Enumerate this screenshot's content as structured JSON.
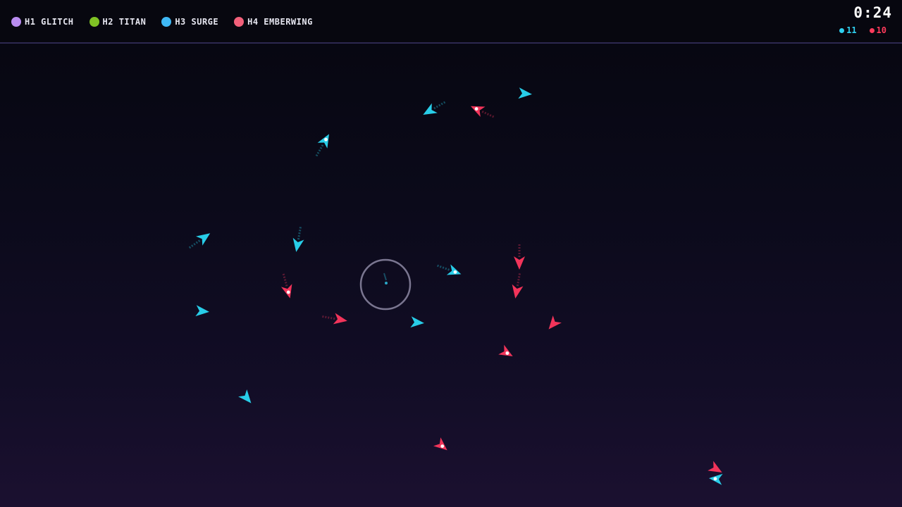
{
  "hud": {
    "heroes": [
      {
        "id": "hero-1",
        "label": "H1 GLITCH",
        "color": "#b98cf0"
      },
      {
        "id": "hero-2",
        "label": "H2 TITAN",
        "color": "#7fc224"
      },
      {
        "id": "hero-3",
        "label": "H3 SURGE",
        "color": "#3fb8f5"
      },
      {
        "id": "hero-4",
        "label": "H4 EMBERWING",
        "color": "#f2607a"
      }
    ],
    "timer": "0:24",
    "scores": {
      "cyan": {
        "value": "11",
        "color": "#2fd0f0"
      },
      "red": {
        "value": "10",
        "color": "#ff3b5c"
      }
    }
  },
  "arena": {
    "team_colors": {
      "cyan": "#28cde8",
      "red": "#f2345a"
    },
    "ring_color": "#7a7690",
    "ships": [
      {
        "team": "cyan",
        "heading": 0,
        "core": false,
        "trail": 0
      },
      {
        "team": "red",
        "heading": 0,
        "core": true,
        "trail": 1
      },
      {
        "team": "cyan",
        "heading": 0,
        "core": false,
        "trail": 1
      },
      {
        "team": "cyan",
        "heading": 0,
        "core": true,
        "trail": 1
      },
      {
        "team": "cyan",
        "heading": 0,
        "core": false,
        "trail": 1
      },
      {
        "team": "cyan",
        "heading": 0,
        "core": false,
        "trail": 1
      },
      {
        "team": "red",
        "heading": 0,
        "core": false,
        "trail": 1
      },
      {
        "team": "red",
        "heading": 0,
        "core": false,
        "trail": 1
      },
      {
        "team": "cyan",
        "heading": 0,
        "core": true,
        "trail": 1
      },
      {
        "team": "red",
        "heading": 0,
        "core": true,
        "trail": 1
      },
      {
        "team": "cyan",
        "heading": 0,
        "core": false,
        "trail": 0
      },
      {
        "team": "red",
        "heading": 0,
        "core": false,
        "trail": 1
      },
      {
        "team": "cyan",
        "heading": 0,
        "core": false,
        "trail": 0
      },
      {
        "team": "red",
        "heading": 0,
        "core": false,
        "trail": 0
      },
      {
        "team": "red",
        "heading": 0,
        "core": true,
        "trail": 0
      },
      {
        "team": "cyan",
        "heading": 0,
        "core": false,
        "trail": 0
      },
      {
        "team": "red",
        "heading": 0,
        "core": true,
        "trail": 0
      },
      {
        "team": "red",
        "heading": 0,
        "core": false,
        "trail": 0
      },
      {
        "team": "cyan",
        "heading": 0,
        "core": true,
        "trail": 0
      },
      {
        "team": "cyan",
        "heading": 0,
        "core": false,
        "trail": 0
      }
    ]
  }
}
